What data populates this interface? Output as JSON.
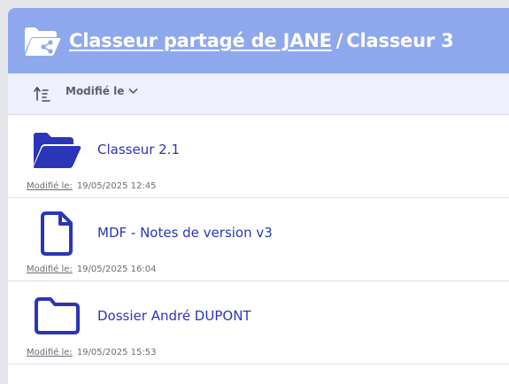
{
  "header": {
    "shared_folder_link": "Classeur partagé de JANE",
    "separator": "/",
    "current": "Classeur 3"
  },
  "toolbar": {
    "sort_label": "Modifié le"
  },
  "items": [
    {
      "type": "folder-open",
      "icon": "folder-open-icon",
      "name": "Classeur 2.1",
      "modified_label": "Modifié le:",
      "modified_value": "19/05/2025 12:45"
    },
    {
      "type": "file",
      "icon": "document-icon",
      "name": "MDF - Notes de version v3",
      "modified_label": "Modifié le:",
      "modified_value": "19/05/2025 16:04"
    },
    {
      "type": "folder",
      "icon": "folder-icon",
      "name": "Dossier André DUPONT",
      "modified_label": "Modifié le:",
      "modified_value": "19/05/2025 15:53"
    }
  ],
  "colors": {
    "header_bg": "#8ea8ee",
    "toolbar_bg": "#eef1fd",
    "accent": "#2b35b8"
  }
}
